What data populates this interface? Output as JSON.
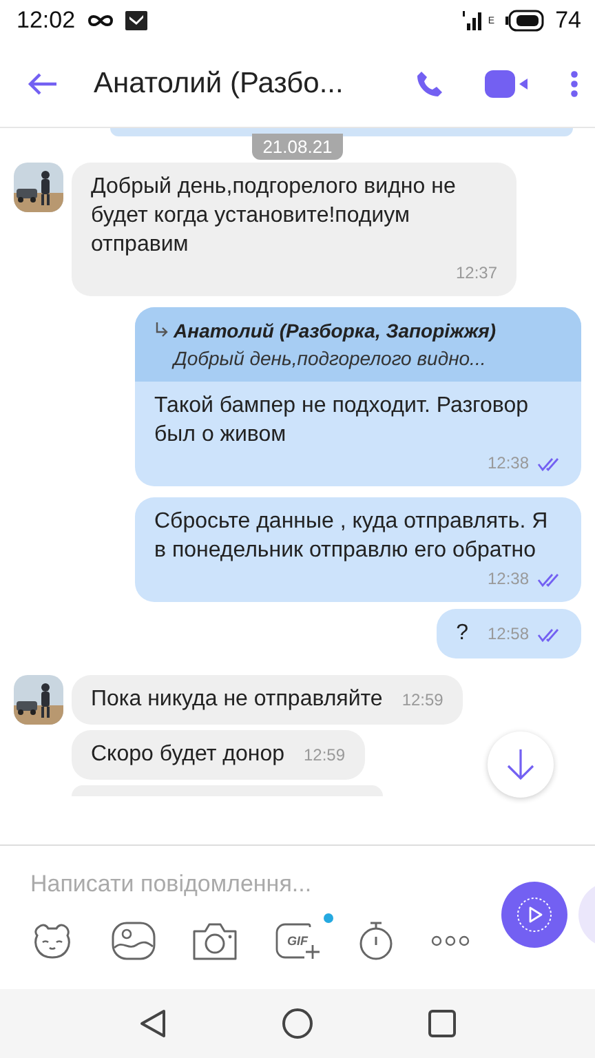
{
  "status_bar": {
    "time": "12:02",
    "network": "E",
    "battery": "74"
  },
  "header": {
    "title": "Анатолий (Разбо..."
  },
  "date_chip": "21.08.21",
  "messages": [
    {
      "kind": "incoming",
      "avatar": true,
      "text": "Добрый день,подгорелого видно не будет когда установите!подиум отправим",
      "time": "12:37"
    },
    {
      "kind": "outgoing",
      "quote": {
        "author": "Анатолий (Разборка, Запоріжжя)",
        "text": "Добрый день,подгорелого видно..."
      },
      "text": "Такой бампер не подходит. Разговор был о живом",
      "time": "12:38",
      "read": true
    },
    {
      "kind": "outgoing",
      "text": "Сбросьте данные , куда отправлять. Я в понедельник отправлю его обратно",
      "time": "12:38",
      "read": true
    },
    {
      "kind": "outgoing",
      "text": "?",
      "time": "12:58",
      "read": true
    },
    {
      "kind": "incoming",
      "avatar": true,
      "text": "Пока никуда не отправляйте",
      "time": "12:59"
    },
    {
      "kind": "incoming",
      "avatar": false,
      "text": "Скоро будет донор",
      "time": "12:59"
    }
  ],
  "composer": {
    "placeholder": "Написати повідомлення...",
    "gif_label": "GIF",
    "gif_badge": true
  }
}
